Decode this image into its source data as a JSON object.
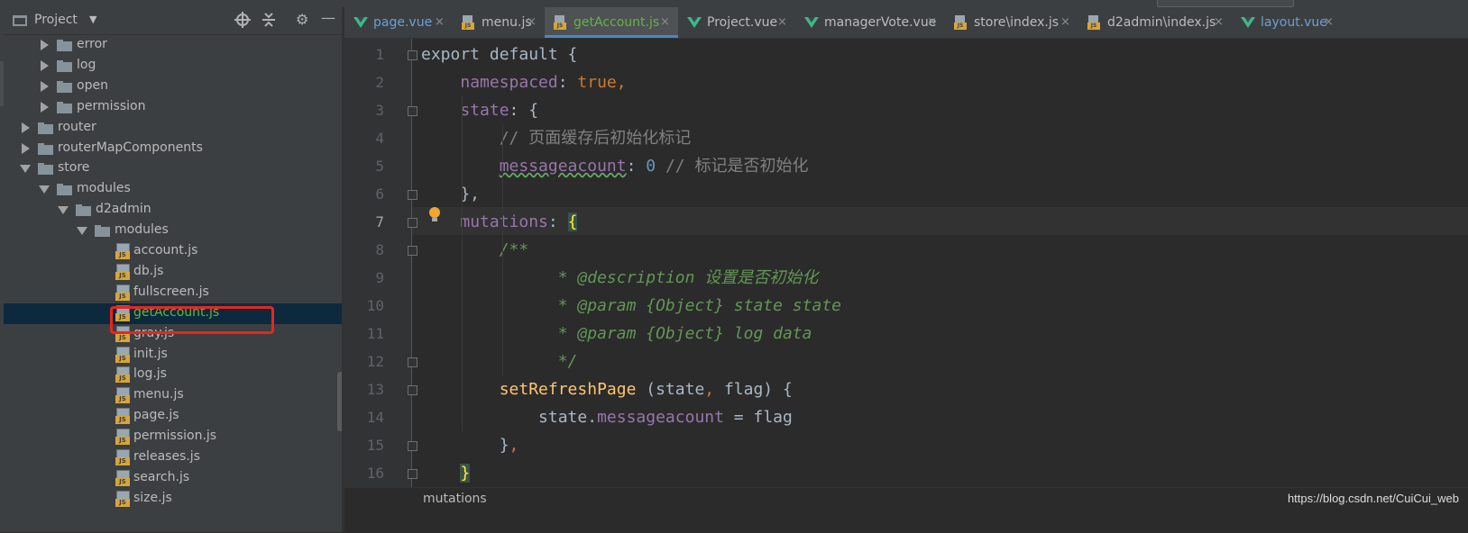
{
  "project_panel": {
    "title": "Project",
    "icons": [
      "target-icon",
      "collapse-all-icon",
      "gear-icon",
      "minimize-icon"
    ],
    "tree": [
      {
        "name": "error",
        "kind": "folder",
        "depth": 3,
        "expanded": false
      },
      {
        "name": "log",
        "kind": "folder",
        "depth": 3,
        "expanded": false
      },
      {
        "name": "open",
        "kind": "folder",
        "depth": 3,
        "expanded": false
      },
      {
        "name": "permission",
        "kind": "folder",
        "depth": 3,
        "expanded": false
      },
      {
        "name": "router",
        "kind": "folder",
        "depth": 2,
        "expanded": false
      },
      {
        "name": "routerMapComponents",
        "kind": "folder",
        "depth": 2,
        "expanded": false
      },
      {
        "name": "store",
        "kind": "folder",
        "depth": 2,
        "expanded": true
      },
      {
        "name": "modules",
        "kind": "folder",
        "depth": 3,
        "expanded": true
      },
      {
        "name": "d2admin",
        "kind": "folder",
        "depth": 4,
        "expanded": true
      },
      {
        "name": "modules",
        "kind": "folder",
        "depth": 5,
        "expanded": true
      },
      {
        "name": "account.js",
        "kind": "js",
        "depth": 6
      },
      {
        "name": "db.js",
        "kind": "js",
        "depth": 6
      },
      {
        "name": "fullscreen.js",
        "kind": "js",
        "depth": 6
      },
      {
        "name": "getAccount.js",
        "kind": "js",
        "depth": 6,
        "selected": true
      },
      {
        "name": "gray.js",
        "kind": "js",
        "depth": 6
      },
      {
        "name": "init.js",
        "kind": "js",
        "depth": 6
      },
      {
        "name": "log.js",
        "kind": "js",
        "depth": 6
      },
      {
        "name": "menu.js",
        "kind": "js",
        "depth": 6
      },
      {
        "name": "page.js",
        "kind": "js",
        "depth": 6
      },
      {
        "name": "permission.js",
        "kind": "js",
        "depth": 6
      },
      {
        "name": "releases.js",
        "kind": "js",
        "depth": 6
      },
      {
        "name": "search.js",
        "kind": "js",
        "depth": 6
      },
      {
        "name": "size.js",
        "kind": "js",
        "depth": 6
      }
    ]
  },
  "tabs": [
    {
      "label": "page.vue",
      "type": "vue",
      "active": false
    },
    {
      "label": "menu.js",
      "type": "js",
      "active": false
    },
    {
      "label": "getAccount.js",
      "type": "js",
      "active": true
    },
    {
      "label": "Project.vue",
      "type": "vue",
      "active": false
    },
    {
      "label": "managerVote.vue",
      "type": "vue",
      "active": false
    },
    {
      "label": "store\\index.js",
      "type": "js",
      "active": false
    },
    {
      "label": "d2admin\\index.js",
      "type": "js",
      "active": false
    },
    {
      "label": "layout.vue",
      "type": "vue",
      "active": false
    }
  ],
  "tab_close_glyph": "×",
  "editor": {
    "current_line": 7,
    "lines": [
      {
        "n": "1",
        "tokens": [
          {
            "t": "export default {",
            "c": "kw-mixed"
          }
        ]
      },
      {
        "n": "2",
        "tokens": [
          {
            "t": "    "
          },
          {
            "t": "namespaced",
            "c": "prop"
          },
          {
            "t": ": "
          },
          {
            "t": "true",
            "c": "kw"
          },
          {
            "t": ",",
            "c": "kw"
          }
        ]
      },
      {
        "n": "3",
        "tokens": [
          {
            "t": "    "
          },
          {
            "t": "state",
            "c": "prop"
          },
          {
            "t": ": {"
          }
        ]
      },
      {
        "n": "4",
        "tokens": [
          {
            "t": "        "
          },
          {
            "t": "// 页面缓存后初始化标记",
            "c": "cmt"
          }
        ]
      },
      {
        "n": "5",
        "tokens": [
          {
            "t": "        "
          },
          {
            "t": "messageacount",
            "c": "prop squig"
          },
          {
            "t": ": "
          },
          {
            "t": "0",
            "c": "num"
          },
          {
            "t": " "
          },
          {
            "t": "// 标记是否初始化",
            "c": "cmt"
          }
        ]
      },
      {
        "n": "6",
        "tokens": [
          {
            "t": "    },"
          }
        ]
      },
      {
        "n": "7",
        "tokens": [
          {
            "t": "    "
          },
          {
            "t": "mutations",
            "c": "prop"
          },
          {
            "t": ": "
          },
          {
            "t": "{",
            "c": "hlb"
          }
        ]
      },
      {
        "n": "8",
        "tokens": [
          {
            "t": "        "
          },
          {
            "t": "/**",
            "c": "doc"
          }
        ]
      },
      {
        "n": "9",
        "tokens": [
          {
            "t": "              "
          },
          {
            "t": "* @description 设置是否初始化",
            "c": "doc"
          }
        ]
      },
      {
        "n": "10",
        "tokens": [
          {
            "t": "              "
          },
          {
            "t": "* @param {Object} state state",
            "c": "doc"
          }
        ]
      },
      {
        "n": "11",
        "tokens": [
          {
            "t": "              "
          },
          {
            "t": "* @param {Object} log data",
            "c": "doc"
          }
        ]
      },
      {
        "n": "12",
        "tokens": [
          {
            "t": "              "
          },
          {
            "t": "*/",
            "c": "doc"
          }
        ]
      },
      {
        "n": "13",
        "tokens": [
          {
            "t": "        "
          },
          {
            "t": "setRefreshPage",
            "c": "fn"
          },
          {
            "t": " (state"
          },
          {
            "t": ",",
            "c": "kw"
          },
          {
            "t": " flag) {"
          }
        ]
      },
      {
        "n": "14",
        "tokens": [
          {
            "t": "            state."
          },
          {
            "t": "messageacount",
            "c": "prop"
          },
          {
            "t": " = flag"
          }
        ]
      },
      {
        "n": "15",
        "tokens": [
          {
            "t": "        }"
          },
          {
            "t": ",",
            "c": "kw"
          }
        ]
      },
      {
        "n": "16",
        "tokens": [
          {
            "t": "    "
          },
          {
            "t": "}",
            "c": "hlb"
          }
        ]
      }
    ]
  },
  "status": {
    "breadcrumb": "mutations",
    "watermark": "https://blog.csdn.net/CuiCui_web"
  }
}
